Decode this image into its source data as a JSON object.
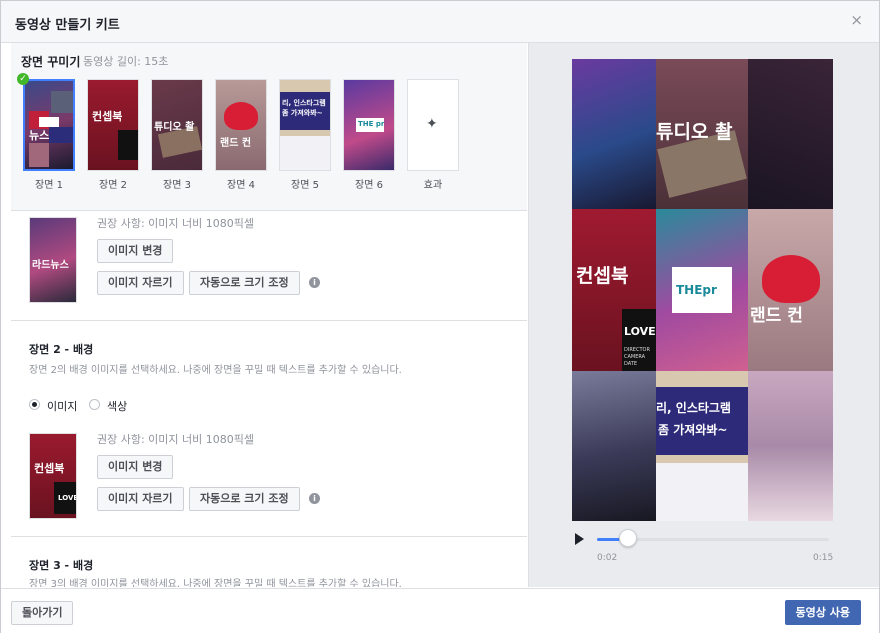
{
  "dialog": {
    "title": "동영상 만들기 키트",
    "close": "×"
  },
  "strip": {
    "label": "장면 꾸미기",
    "duration": "동영상 길이: 15초",
    "scenes": [
      {
        "label": "장면 1",
        "selected": true,
        "thumb_text": "뉴스"
      },
      {
        "label": "장면 2",
        "thumb_text": "컨셉북"
      },
      {
        "label": "장면 3",
        "thumb_text": "튜디오 촬"
      },
      {
        "label": "장면 4",
        "thumb_text": "랜드 컨"
      },
      {
        "label": "장면 5",
        "thumb_text": "리, 인스타그램 좀 가져와봐~"
      },
      {
        "label": "장면 6",
        "thumb_text": "THE pr"
      },
      {
        "label": "효과",
        "thumb_text": ""
      }
    ]
  },
  "scene1": {
    "recommend": "권장 사항: 이미지 너비 1080픽셀",
    "change": "이미지 변경",
    "crop": "이미지 자르기",
    "autosize": "자동으로 크기 조정",
    "thumb_text": "라드뉴스"
  },
  "scene2": {
    "title": "장면 2 - 배경",
    "desc": "장면 2의 배경 이미지를 선택하세요. 나중에 장면을 꾸밀 때 텍스트를 추가할 수 있습니다.",
    "opt_image": "이미지",
    "opt_color": "색상",
    "recommend": "권장 사항: 이미지 너비 1080픽셀",
    "change": "이미지 변경",
    "crop": "이미지 자르기",
    "autosize": "자동으로 크기 조정",
    "thumb_text": "컨셉북",
    "thumb_sub": "LOVE"
  },
  "scene3": {
    "title": "장면 3 - 배경",
    "desc": "장면 3의 배경 이미지를 선택하세요. 나중에 장면을 꾸밀 때 텍스트를 추가할 수 있습니다."
  },
  "preview": {
    "texts": {
      "studio": "튜디오 촬",
      "concept": "컨셉북",
      "brand": "랜드 컨",
      "insta1": "리, 인스타그램",
      "insta2": "좀 가져와봐~",
      "logo": "THEpr",
      "love": "LOVE",
      "director": "DIRECTOR",
      "camera": "CAMERA",
      "date": "DATE"
    },
    "player": {
      "current": "0:02",
      "total": "0:15",
      "progress": 0.133
    }
  },
  "footer": {
    "back": "돌아가기",
    "use": "동영상 사용"
  },
  "colors": {
    "accent": "#4267b2",
    "check": "#42b72a",
    "progress": "#4080ff"
  }
}
